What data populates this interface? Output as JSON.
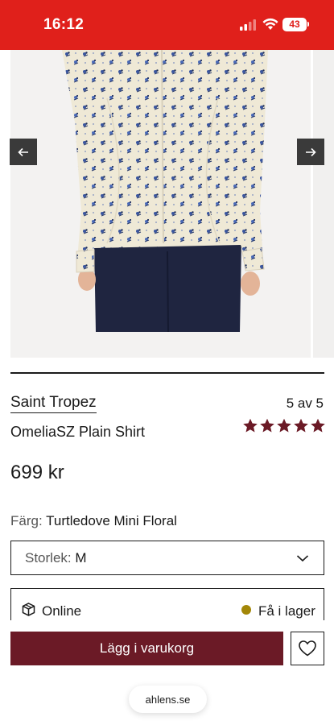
{
  "status_bar": {
    "time": "16:12",
    "battery": "43",
    "bar_color": "#e0201b"
  },
  "gallery": {
    "prev_icon": "arrow-left-icon",
    "next_icon": "arrow-right-icon"
  },
  "product": {
    "brand": "Saint Tropez",
    "image_counter": "5 av 5",
    "name": "OmeliaSZ Plain Shirt",
    "rating": 5,
    "rating_max": 5,
    "rating_color": "#6b1a26",
    "price": "699 kr"
  },
  "color": {
    "label": "Färg:",
    "value": "Turtledove Mini Floral"
  },
  "size": {
    "label": "Storlek:",
    "value": "M"
  },
  "stock": {
    "online_label": "Online",
    "status": "Få i lager",
    "status_color": "#a38708"
  },
  "actions": {
    "add_to_cart": "Lägg i varukorg",
    "button_color": "#6b1a26"
  },
  "browser": {
    "url": "ahlens.se"
  }
}
